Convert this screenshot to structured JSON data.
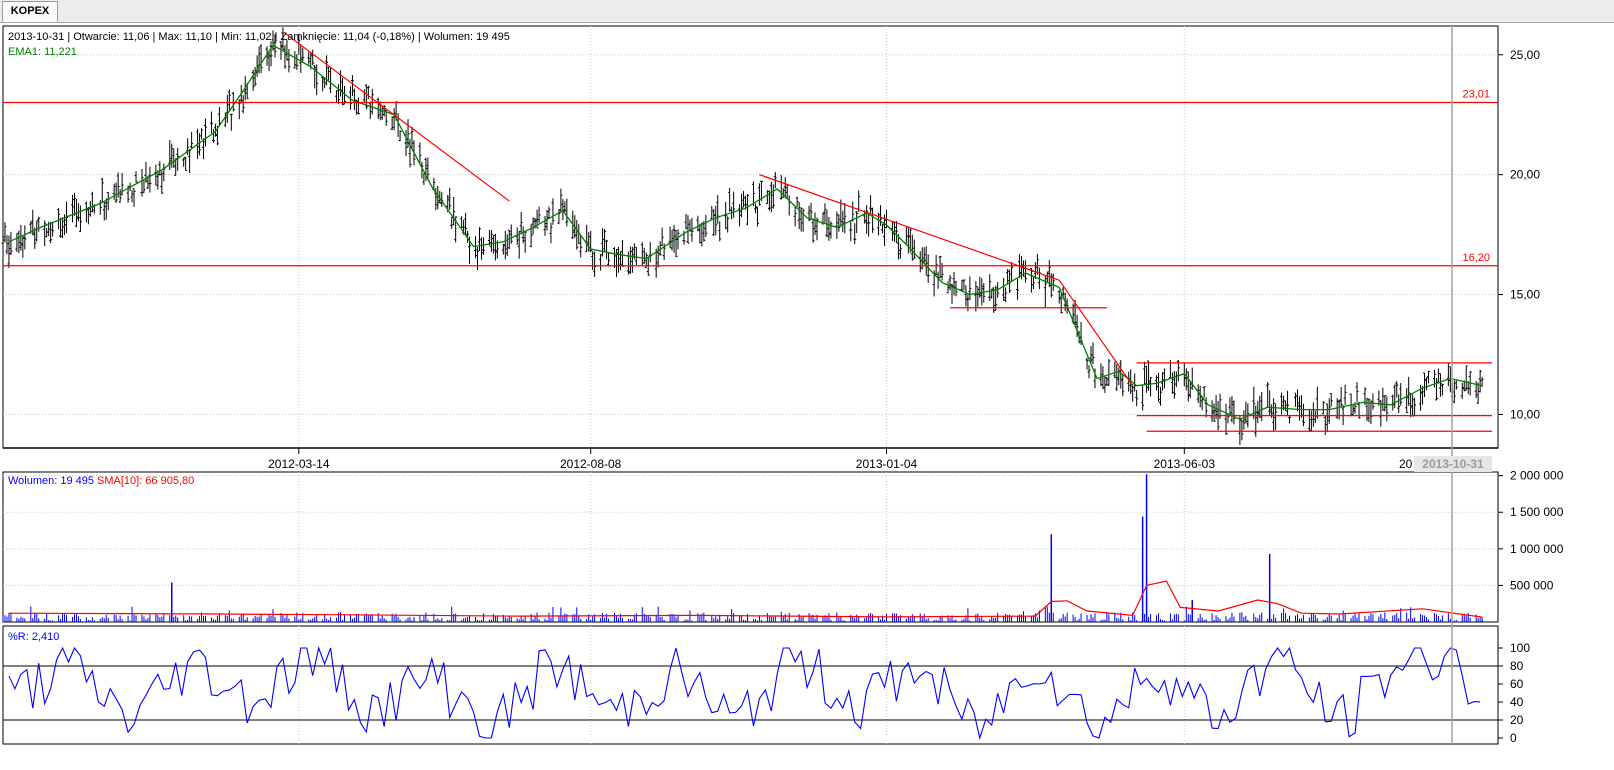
{
  "tab": {
    "label": "KOPEX"
  },
  "info": {
    "line1": "2013-10-31 | Otwarcie: 11,06 | Max: 11,10 | Min: 11,02 | Zamknięcie: 11,04 (-0,18%)  | Wolumen: 19 495",
    "ema_label": "EMA1: 11,221",
    "volume_label": "Wolumen: 19 495",
    "sma_label": "SMA[10]: 66 905,80",
    "wr_label": "%R: 2,410",
    "crosshair_date": "2013-10-31",
    "partial_date": "20"
  },
  "colors": {
    "price": "#000000",
    "ema": "#008000",
    "line": "#ff0000",
    "volume": "#0000ff",
    "sma": "#ff0000",
    "wr": "#0000ff",
    "crosshair": "#a0a0a0",
    "grid": "#c8c8c8"
  },
  "chart_data": [
    {
      "type": "ohlc",
      "x_ticks": [
        "2012-03-14",
        "2012-08-08",
        "2013-01-04",
        "2013-06-03"
      ],
      "y_ticks": [
        "10,00",
        "15,00",
        "20,00",
        "25,00"
      ],
      "ylim": [
        8.6,
        26.2
      ],
      "grid": true,
      "level_labels": [
        "23,01",
        "16,20"
      ],
      "series": [
        {
          "name": "EMA1",
          "type": "line",
          "x": [
            "2011-10-20",
            "2011-11-05",
            "2011-12-05",
            "2012-01-05",
            "2012-02-01",
            "2012-02-15",
            "2012-03-01",
            "2012-03-20",
            "2012-04-10",
            "2012-05-01",
            "2012-05-20",
            "2012-06-10",
            "2012-06-25",
            "2012-07-10",
            "2012-07-25",
            "2012-08-08",
            "2012-08-20",
            "2012-09-05",
            "2012-09-25",
            "2012-10-10",
            "2012-10-25",
            "2012-11-10",
            "2012-11-25",
            "2012-12-10",
            "2012-12-25",
            "2013-01-04",
            "2013-01-15",
            "2013-02-01",
            "2013-02-15",
            "2013-03-01",
            "2013-03-15",
            "2013-04-01",
            "2013-04-10",
            "2013-04-20",
            "2013-05-01",
            "2013-05-10",
            "2013-05-20",
            "2013-06-03",
            "2013-06-15",
            "2013-07-01",
            "2013-07-15",
            "2013-08-01",
            "2013-08-15",
            "2013-09-01",
            "2013-09-15",
            "2013-10-01",
            "2013-10-15",
            "2013-10-31"
          ],
          "values": [
            17.2,
            17.8,
            18.8,
            20.2,
            21.8,
            23.5,
            25.4,
            24.5,
            23.1,
            22.5,
            19.5,
            17.0,
            17.2,
            17.8,
            18.5,
            16.9,
            16.7,
            16.5,
            17.6,
            18.2,
            18.6,
            19.4,
            18.2,
            17.8,
            18.4,
            17.9,
            17.0,
            15.5,
            15.0,
            15.2,
            15.9,
            15.3,
            13.5,
            11.5,
            11.8,
            11.2,
            11.3,
            11.7,
            10.4,
            9.8,
            10.3,
            10.2,
            10.2,
            10.5,
            10.4,
            11.1,
            11.5,
            11.2
          ]
        },
        {
          "name": "Level 23,01",
          "type": "hline",
          "value": 23.01
        },
        {
          "name": "Level 16,20",
          "type": "hline",
          "value": 16.2
        }
      ],
      "trendlines": [
        {
          "x": [
            "2012-03-07",
            "2012-06-28"
          ],
          "y": [
            25.9,
            18.9
          ]
        },
        {
          "x": [
            "2012-11-01",
            "2013-04-01"
          ],
          "y": [
            20.0,
            15.6
          ]
        },
        {
          "x": [
            "2013-04-01",
            "2013-05-08"
          ],
          "y": [
            15.6,
            11.2
          ]
        }
      ],
      "segments": [
        {
          "x": [
            "2013-02-05",
            "2013-04-25"
          ],
          "y": [
            14.45,
            14.45
          ]
        },
        {
          "x": [
            "2013-05-10",
            "2013-11-05"
          ],
          "y": [
            12.15,
            12.15
          ]
        },
        {
          "x": [
            "2013-05-10",
            "2013-11-05"
          ],
          "y": [
            9.95,
            9.95
          ]
        },
        {
          "x": [
            "2013-05-15",
            "2013-11-05"
          ],
          "y": [
            9.3,
            9.3
          ]
        }
      ]
    },
    {
      "type": "bar",
      "series": [
        {
          "name": "Wolumen",
          "spikes": [
            {
              "x": "2013-05-15",
              "value": 2020000
            },
            {
              "x": "2013-05-13",
              "value": 1440000
            },
            {
              "x": "2013-03-28",
              "value": 1200000
            },
            {
              "x": "2013-07-16",
              "value": 930000
            },
            {
              "x": "2012-01-10",
              "value": 540000
            },
            {
              "x": "2013-06-07",
              "value": 300000
            },
            {
              "x": "2013-10-31",
              "value": 19495
            }
          ]
        },
        {
          "name": "SMA[10]",
          "type": "line",
          "x": [
            "2011-10-20",
            "2012-02-01",
            "2012-04-01",
            "2012-07-01",
            "2012-10-01",
            "2013-01-04",
            "2013-03-20",
            "2013-03-28",
            "2013-04-05",
            "2013-04-15",
            "2013-05-08",
            "2013-05-15",
            "2013-05-25",
            "2013-06-01",
            "2013-06-20",
            "2013-07-10",
            "2013-07-20",
            "2013-08-01",
            "2013-08-20",
            "2013-10-01",
            "2013-10-31"
          ],
          "values": [
            120000,
            110000,
            100000,
            80000,
            90000,
            70000,
            80000,
            280000,
            290000,
            150000,
            90000,
            500000,
            560000,
            200000,
            150000,
            300000,
            250000,
            120000,
            110000,
            180000,
            66905.8
          ]
        }
      ],
      "y_ticks": [
        "500 000",
        "1 000 000",
        "1 500 000",
        "2 000 000"
      ],
      "ylim": [
        0,
        2050000
      ]
    },
    {
      "type": "line",
      "series": [
        {
          "name": "%R",
          "x": [
            "2011-10-20",
            "2011-11-20",
            "2011-12-20",
            "2012-01-20",
            "2012-02-20",
            "2012-03-20",
            "2012-04-20",
            "2012-05-20",
            "2012-06-20",
            "2012-07-20",
            "2012-08-20",
            "2012-09-20",
            "2012-10-20",
            "2012-11-20",
            "2012-12-20",
            "2013-01-20",
            "2013-02-20",
            "2013-03-20",
            "2013-04-20",
            "2013-05-20",
            "2013-06-20",
            "2013-07-20",
            "2013-08-20",
            "2013-09-20",
            "2013-10-20",
            "2013-10-31"
          ],
          "values": [
            45,
            80,
            20,
            85,
            40,
            95,
            30,
            70,
            10,
            85,
            25,
            75,
            15,
            90,
            35,
            80,
            5,
            90,
            10,
            80,
            20,
            95,
            15,
            85,
            95,
            2.41
          ]
        }
      ],
      "y_ticks": [
        "0",
        "20",
        "40",
        "60",
        "80",
        "100"
      ],
      "ylim": [
        0,
        100
      ],
      "levels": [
        20,
        80
      ]
    }
  ]
}
